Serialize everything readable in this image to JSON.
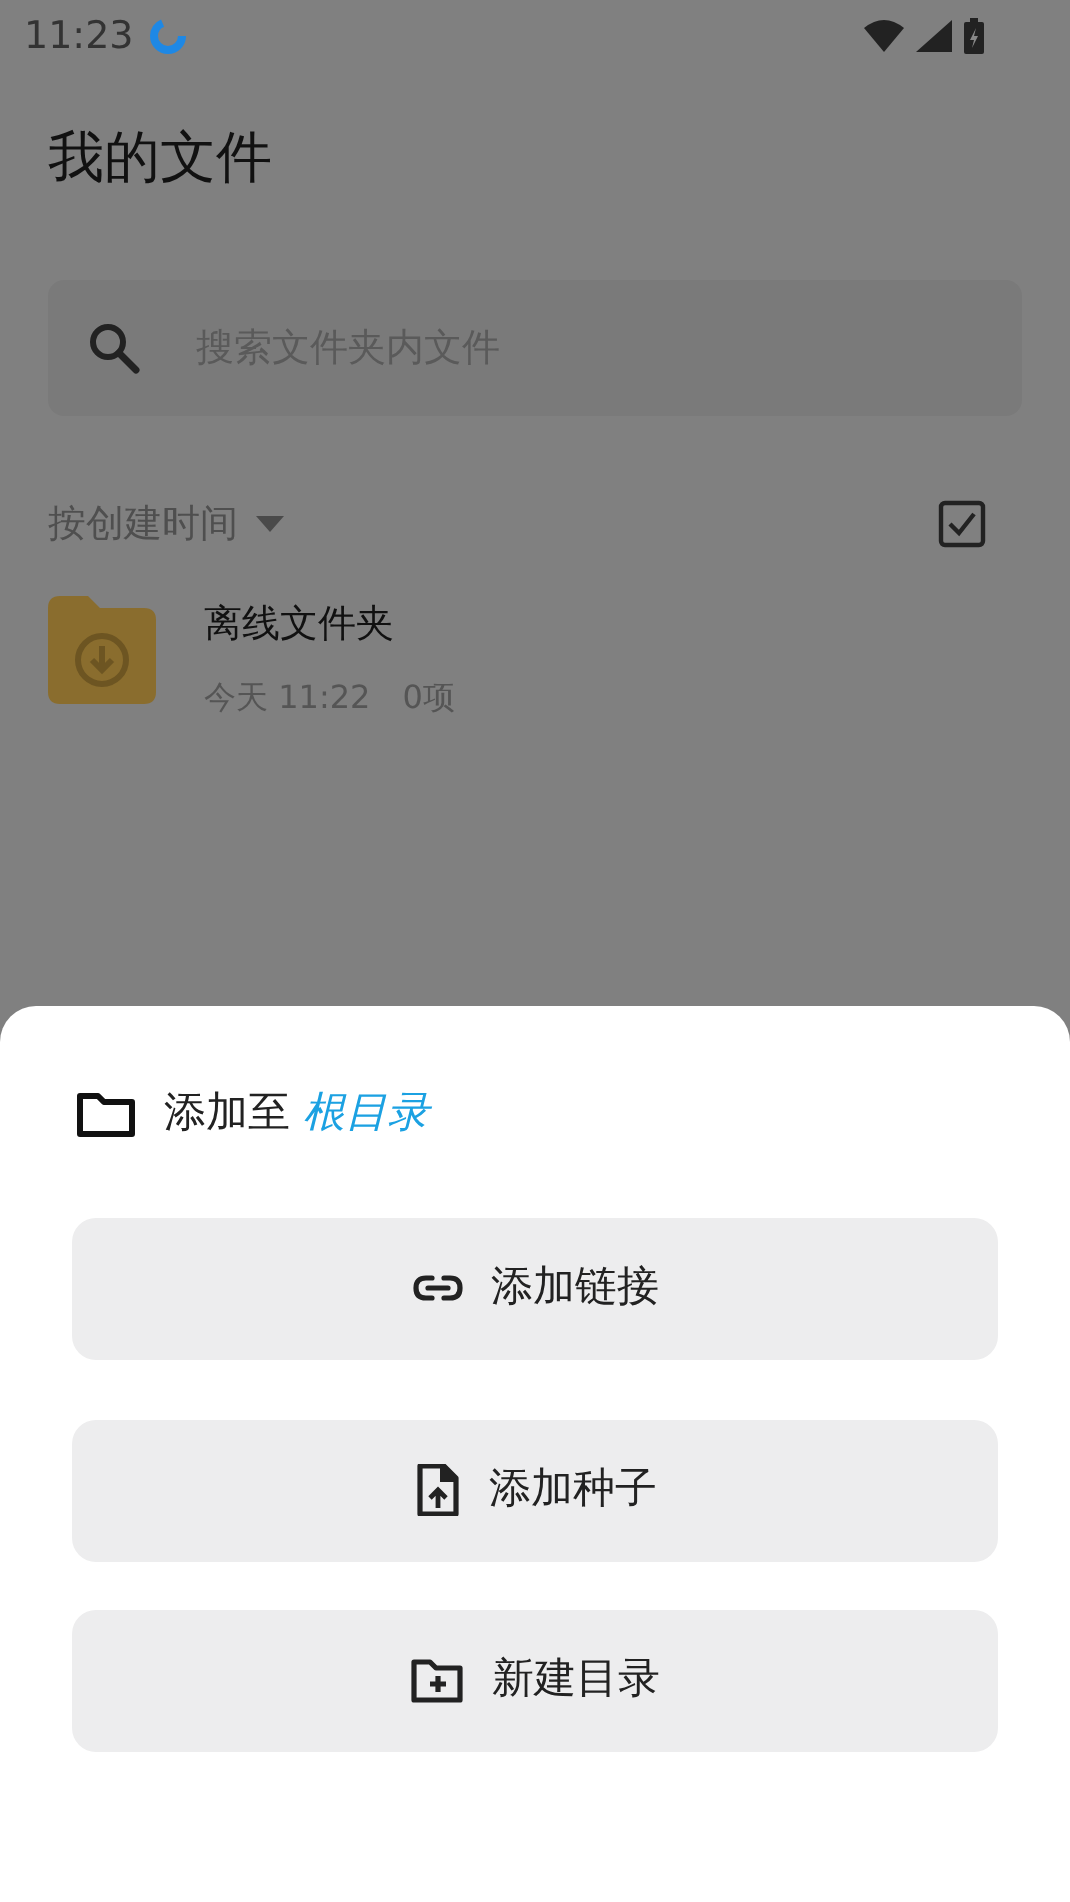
{
  "status_bar": {
    "time": "11:23"
  },
  "title": "我的文件",
  "search": {
    "placeholder": "搜索文件夹内文件"
  },
  "sort": {
    "label": "按创建时间",
    "select_all_checked": true
  },
  "items": [
    {
      "name": "离线文件夹",
      "date": "今天 11:22",
      "count": "0项"
    }
  ],
  "sheet": {
    "prefix": "添加至",
    "target": "根目录",
    "actions": [
      {
        "kind": "link",
        "label": "添加链接"
      },
      {
        "kind": "torrent",
        "label": "添加种子"
      },
      {
        "kind": "folder",
        "label": "新建目录"
      }
    ]
  }
}
